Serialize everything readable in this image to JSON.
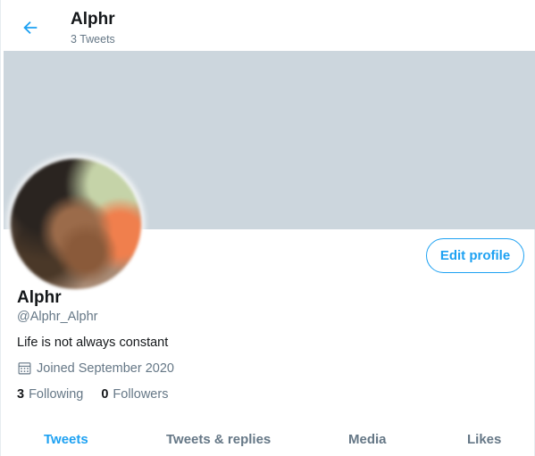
{
  "header": {
    "name": "Alphr",
    "tweet_count": "3 Tweets"
  },
  "profile": {
    "edit_label": "Edit profile",
    "name": "Alphr",
    "handle": "@Alphr_Alphr",
    "bio": "Life is not always constant",
    "joined": "Joined September 2020",
    "following_count": "3",
    "following_label": "Following",
    "followers_count": "0",
    "followers_label": "Followers"
  },
  "tabs": [
    {
      "label": "Tweets",
      "active": true
    },
    {
      "label": "Tweets & replies",
      "active": false
    },
    {
      "label": "Media",
      "active": false
    },
    {
      "label": "Likes",
      "active": false
    }
  ],
  "colors": {
    "accent": "#1da1f2",
    "banner": "#ccd6dd",
    "muted_text": "#657786",
    "text": "#14171a"
  },
  "icons": {
    "back": "arrow-left-icon",
    "joined": "calendar-icon"
  }
}
